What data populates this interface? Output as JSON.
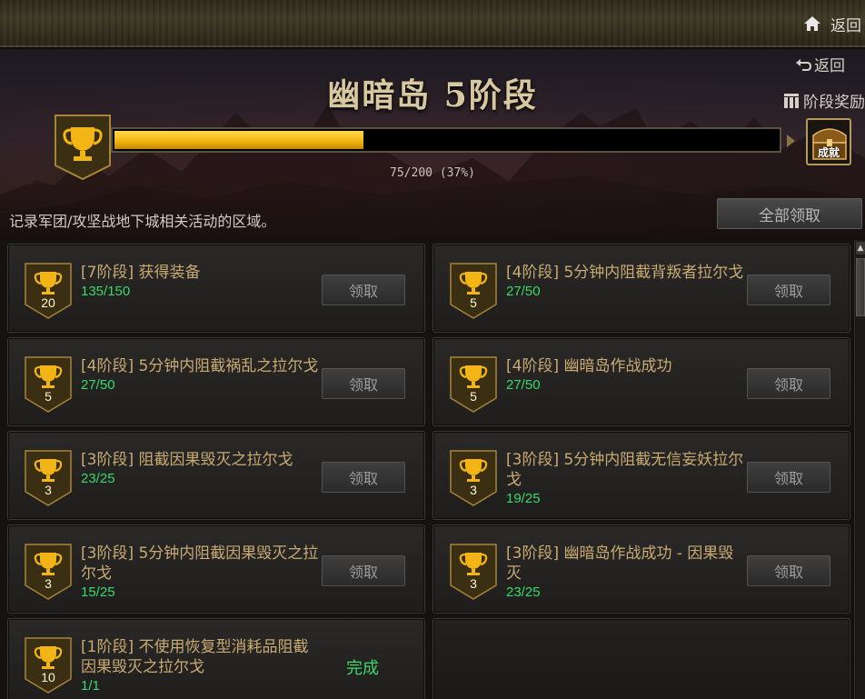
{
  "header": {
    "home_label": "返回"
  },
  "banner": {
    "title": "幽暗岛 5阶段",
    "back_label": "返回",
    "stage_reward_label": "阶段奖励",
    "progress_text": "75/200 (37%)",
    "progress_fraction": 0.375,
    "chest_label": "成就",
    "description": "记录军团/攻坚战地下城相关活动的区域。",
    "claim_all_label": "全部领取"
  },
  "tasks": [
    {
      "title": "[7阶段] 获得装备",
      "progress": "135/150",
      "points": "20",
      "action": "领取",
      "done": false
    },
    {
      "title": "[4阶段] 5分钟内阻截背叛者拉尔戈",
      "progress": "27/50",
      "points": "5",
      "action": "领取",
      "done": false
    },
    {
      "title": "[4阶段] 5分钟内阻截祸乱之拉尔戈",
      "progress": "27/50",
      "points": "5",
      "action": "领取",
      "done": false
    },
    {
      "title": "[4阶段] 幽暗岛作战成功",
      "progress": "27/50",
      "points": "5",
      "action": "领取",
      "done": false
    },
    {
      "title": "[3阶段] 阻截因果毁灭之拉尔戈",
      "progress": "23/25",
      "points": "3",
      "action": "领取",
      "done": false
    },
    {
      "title": "[3阶段] 5分钟内阻截无信妄妖拉尔戈",
      "progress": "19/25",
      "points": "3",
      "action": "领取",
      "done": false
    },
    {
      "title": "[3阶段] 5分钟内阻截因果毁灭之拉尔戈",
      "progress": "15/25",
      "points": "3",
      "action": "领取",
      "done": false
    },
    {
      "title": "[3阶段] 幽暗岛作战成功 - 因果毁灭",
      "progress": "23/25",
      "points": "3",
      "action": "领取",
      "done": false
    },
    {
      "title": "[1阶段] 不使用恢复型消耗品阻截因果毁灭之拉尔戈",
      "progress": "1/1",
      "points": "10",
      "action": "完成",
      "done": true
    }
  ],
  "colors": {
    "progress_fill": "#f0b20f",
    "task_title": "#c8aa72",
    "task_progress": "#39d86a",
    "done": "#3dd86a"
  },
  "icons": {
    "home": "home-icon",
    "back": "return-arrow-icon",
    "reward": "gift-icon",
    "trophy": "trophy-icon",
    "chest": "treasure-chest-icon"
  }
}
